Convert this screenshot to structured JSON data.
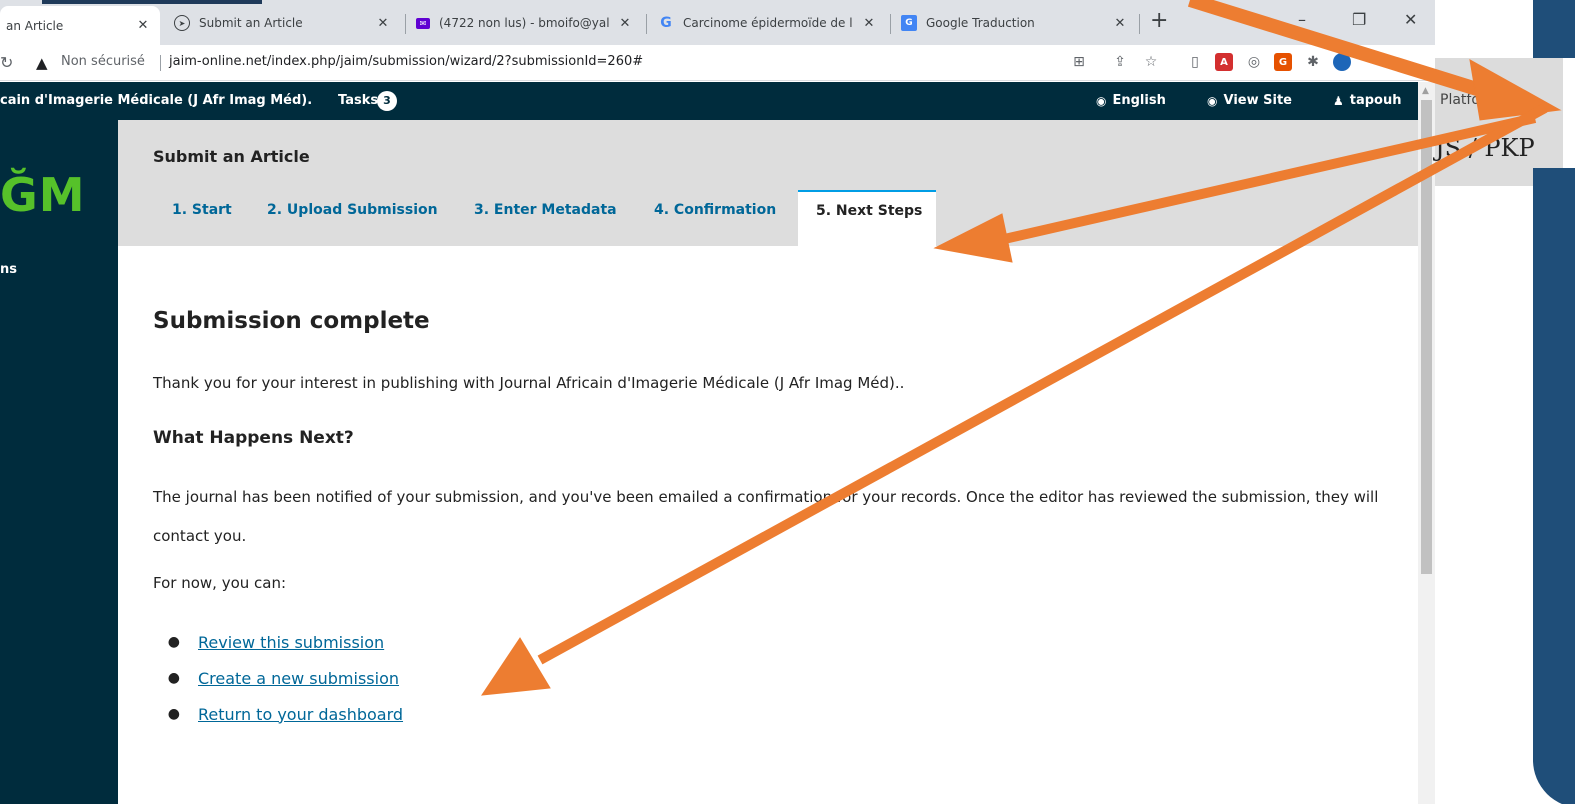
{
  "browser": {
    "tabs": [
      {
        "title": "an Article",
        "icon": "document-icon",
        "active": true
      },
      {
        "title": "Submit an Article",
        "icon": "ojs-icon",
        "active": false
      },
      {
        "title": "(4722 non lus) - bmoifo@yal",
        "icon": "mail-icon",
        "active": false
      },
      {
        "title": "Carcinome épidermoïde de l",
        "icon": "google-icon",
        "active": false
      },
      {
        "title": "Google Traduction",
        "icon": "translate-icon",
        "active": false
      }
    ],
    "new_tab": "+",
    "window_controls": [
      "–",
      "❐",
      "✕"
    ],
    "security_label": "Non sécurisé",
    "url": "jaim-online.net/index.php/jaim/submission/wizard/2?submissionId=260#"
  },
  "topnav": {
    "site_name": "cain d'Imagerie Médicale (J Afr Imag Méd).",
    "tasks_label": "Tasks",
    "tasks_count": "3",
    "language_label": "English",
    "view_site_label": "View Site",
    "user_label": "tapouh"
  },
  "sidebar": {
    "logo_text": "ĞM",
    "link_label": "ns"
  },
  "header": {
    "title": "Submit an Article",
    "steps": [
      {
        "label": "1. Start"
      },
      {
        "label": "2. Upload Submission"
      },
      {
        "label": "3. Enter Metadata"
      },
      {
        "label": "4. Confirmation"
      },
      {
        "label": "5. Next Steps"
      }
    ]
  },
  "content": {
    "heading": "Submission complete",
    "thanks_text": "Thank you for your interest in publishing with Journal Africain d'Imagerie Médicale (J Afr Imag Méd)..",
    "next_heading": "What Happens Next?",
    "notified_text": "The journal has been notified of your submission, and you've been emailed a confirmation for your records. Once the editor has reviewed the submission, they will contact you.",
    "for_now_text": "For now, you can:",
    "actions": [
      {
        "label": "Review this submission"
      },
      {
        "label": "Create a new submission"
      },
      {
        "label": "Return to your dashboard"
      }
    ]
  },
  "overlay": {
    "pkp_line1": "Platfo... y",
    "pkp_line2": "JS / PKP"
  },
  "colors": {
    "nav_bg": "#002c3d",
    "link": "#006798",
    "active_tab_border": "#009de5",
    "logo_green": "#56c12a",
    "arrow": "#ed7d31",
    "overlay_blue": "#1f4e79"
  }
}
